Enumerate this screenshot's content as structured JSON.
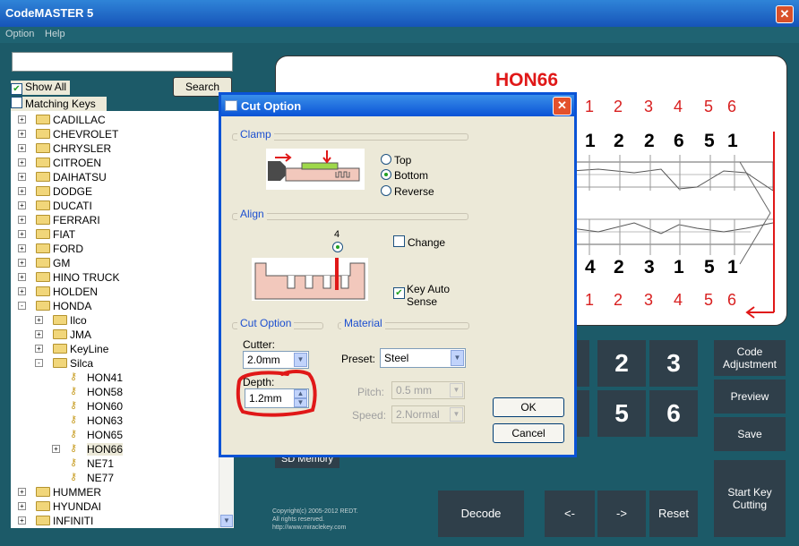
{
  "app": {
    "title": "CodeMASTER 5"
  },
  "menu": [
    "Option",
    "Help"
  ],
  "left": {
    "search_value": "",
    "show_all": "Show All",
    "matching_keys": "Matching Keys",
    "search_button": "Search",
    "tree": [
      {
        "label": "CADILLAC",
        "level": 0,
        "exp": "+",
        "type": "folder"
      },
      {
        "label": "CHEVROLET",
        "level": 0,
        "exp": "+",
        "type": "folder"
      },
      {
        "label": "CHRYSLER",
        "level": 0,
        "exp": "+",
        "type": "folder"
      },
      {
        "label": "CITROEN",
        "level": 0,
        "exp": "+",
        "type": "folder"
      },
      {
        "label": "DAIHATSU",
        "level": 0,
        "exp": "+",
        "type": "folder"
      },
      {
        "label": "DODGE",
        "level": 0,
        "exp": "+",
        "type": "folder"
      },
      {
        "label": "DUCATI",
        "level": 0,
        "exp": "+",
        "type": "folder"
      },
      {
        "label": "FERRARI",
        "level": 0,
        "exp": "+",
        "type": "folder"
      },
      {
        "label": "FIAT",
        "level": 0,
        "exp": "+",
        "type": "folder"
      },
      {
        "label": "FORD",
        "level": 0,
        "exp": "+",
        "type": "folder"
      },
      {
        "label": "GM",
        "level": 0,
        "exp": "+",
        "type": "folder"
      },
      {
        "label": "HINO TRUCK",
        "level": 0,
        "exp": "+",
        "type": "folder"
      },
      {
        "label": "HOLDEN",
        "level": 0,
        "exp": "+",
        "type": "folder"
      },
      {
        "label": "HONDA",
        "level": 0,
        "exp": "-",
        "type": "folder"
      },
      {
        "label": "Ilco",
        "level": 1,
        "exp": "+",
        "type": "folder"
      },
      {
        "label": "JMA",
        "level": 1,
        "exp": "+",
        "type": "folder"
      },
      {
        "label": "KeyLine",
        "level": 1,
        "exp": "+",
        "type": "folder"
      },
      {
        "label": "Silca",
        "level": 1,
        "exp": "-",
        "type": "folder"
      },
      {
        "label": "HON41",
        "level": 2,
        "exp": "",
        "type": "key"
      },
      {
        "label": "HON58",
        "level": 2,
        "exp": "",
        "type": "key"
      },
      {
        "label": "HON60",
        "level": 2,
        "exp": "",
        "type": "key"
      },
      {
        "label": "HON63",
        "level": 2,
        "exp": "",
        "type": "key"
      },
      {
        "label": "HON65",
        "level": 2,
        "exp": "",
        "type": "key"
      },
      {
        "label": "HON66",
        "level": 2,
        "exp": "+",
        "type": "key",
        "selected": true
      },
      {
        "label": "NE71",
        "level": 2,
        "exp": "",
        "type": "key"
      },
      {
        "label": "NE77",
        "level": 2,
        "exp": "",
        "type": "key"
      },
      {
        "label": "HUMMER",
        "level": 0,
        "exp": "+",
        "type": "folder"
      },
      {
        "label": "HYUNDAI",
        "level": 0,
        "exp": "+",
        "type": "folder"
      },
      {
        "label": "INFINITI",
        "level": 0,
        "exp": "+",
        "type": "folder"
      }
    ]
  },
  "key": {
    "title": "HON66",
    "top_positions": [
      "1",
      "2",
      "3",
      "4",
      "5",
      "6"
    ],
    "top_cuts": [
      "1",
      "2",
      "2",
      "6",
      "5",
      "1"
    ],
    "bottom_cuts": [
      "4",
      "2",
      "3",
      "1",
      "5",
      "1"
    ],
    "bottom_positions": [
      "1",
      "2",
      "3",
      "4",
      "5",
      "6"
    ]
  },
  "keypad": {
    "k2": "2",
    "k3": "3",
    "k5": "5",
    "k6": "6"
  },
  "side_buttons": {
    "code_adjustment": "Code Adjustment",
    "preview": "Preview",
    "save": "Save",
    "start": "Start Key Cutting"
  },
  "bottom_buttons": {
    "decode": "Decode",
    "prev": "<-",
    "next": "->",
    "reset": "Reset"
  },
  "sd_memory": "SD Memory",
  "copyright": [
    "Copyright(c) 2005-2012 REDT.",
    "All rights reserved.",
    "http://www.miraclekey.com"
  ],
  "dialog": {
    "title": "Cut Option",
    "clamp_group": "Clamp",
    "clamp_options": [
      "Top",
      "Bottom",
      "Reverse"
    ],
    "clamp_selected": "Bottom",
    "align_group": "Align",
    "align_number": "4",
    "change_label": "Change",
    "key_auto_sense": "Key Auto Sense",
    "cut_option_group": "Cut Option",
    "material_group": "Material",
    "cutter_label": "Cutter:",
    "cutter_value": "2.0mm",
    "depth_label": "Depth:",
    "depth_value": "1.2mm",
    "preset_label": "Preset:",
    "preset_value": "Steel",
    "pitch_label": "Pitch:",
    "pitch_value": "0.5 mm",
    "speed_label": "Speed:",
    "speed_value": "2.Normal",
    "ok": "OK",
    "cancel": "Cancel"
  },
  "colors": {
    "accent_red": "#e01818",
    "titlebar_blue": "#0a53d6",
    "panel_teal": "#1c5a68",
    "button_dark": "#2f3f4a"
  }
}
